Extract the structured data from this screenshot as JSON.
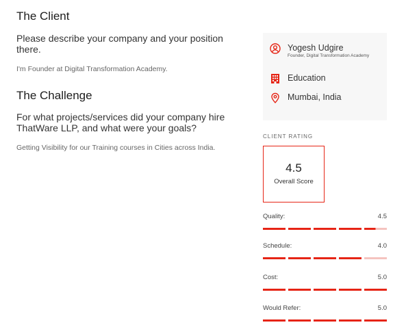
{
  "client": {
    "title": "The Client",
    "question": "Please describe your company and your position there.",
    "answer": "I'm Founder at Digital Transformation Academy."
  },
  "challenge": {
    "title": "The Challenge",
    "question": "For what projects/services did your company hire ThatWare LLP, and what were your goals?",
    "answer": "Getting Visibility for our Training courses in Cities across India."
  },
  "card": {
    "name": "Yogesh Udgire",
    "position": "Founder, Digital Transformation Academy",
    "industry": "Education",
    "location": "Mumbai, India",
    "icons": [
      "person-icon",
      "building-icon",
      "location-pin-icon"
    ],
    "accent_color": "#e62415"
  },
  "rating": {
    "label": "CLIENT RATING",
    "overall_value": "4.5",
    "overall_caption": "Overall Score",
    "metrics": [
      {
        "name": "Quality:",
        "value": "4.5",
        "score": 4.5
      },
      {
        "name": "Schedule:",
        "value": "4.0",
        "score": 4.0
      },
      {
        "name": "Cost:",
        "value": "5.0",
        "score": 5.0
      },
      {
        "name": "Would Refer:",
        "value": "5.0",
        "score": 5.0
      }
    ]
  }
}
